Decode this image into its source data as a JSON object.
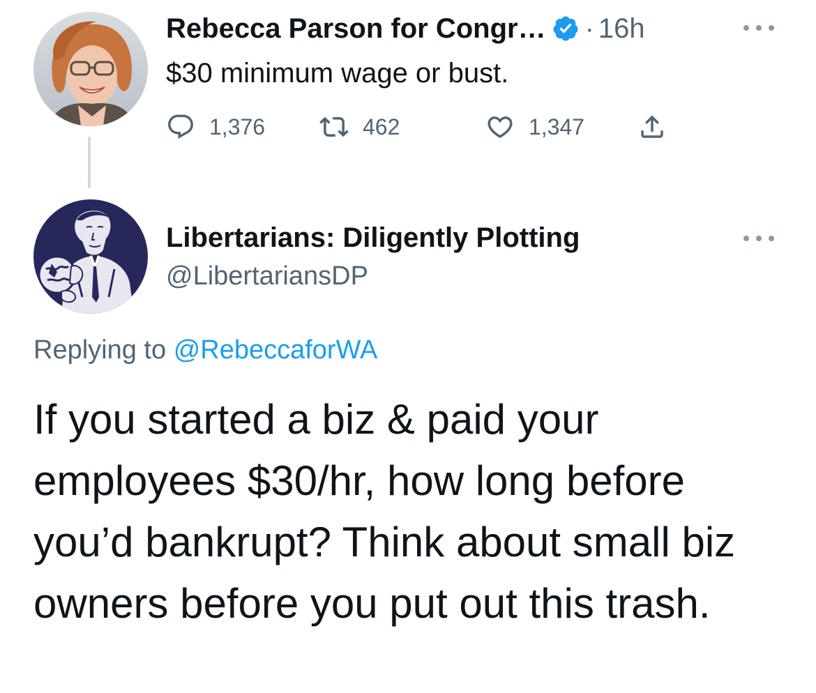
{
  "parent_tweet": {
    "author_name": "Rebecca Parson for Congr…",
    "separator": "·",
    "time": "16h",
    "text": "$30 minimum wage or bust.",
    "stats": {
      "replies": "1,376",
      "retweets": "462",
      "likes": "1,347"
    },
    "verified": true
  },
  "reply_tweet": {
    "author_name": "Libertarians: Diligently Plotting",
    "handle": "@LibertariansDP",
    "replying_prefix": "Replying to",
    "replying_to": "@RebeccaforWA",
    "text": "If you started a biz & paid your employees $30/hr, how long before you’d bankrupt? Think about small biz owners before you put out this trash."
  },
  "icons": {
    "reply": "reply-icon",
    "retweet": "retweet-icon",
    "like": "heart-icon",
    "share": "share-icon",
    "verified": "verified-badge-icon",
    "more": "more-options-icon"
  },
  "colors": {
    "text_primary": "#0f1419",
    "text_secondary": "#536471",
    "link": "#1d9bf0",
    "verified": "#1d9bf0",
    "thread_line": "#cfd9de",
    "libertarian_avatar_bg": "#26285c"
  }
}
